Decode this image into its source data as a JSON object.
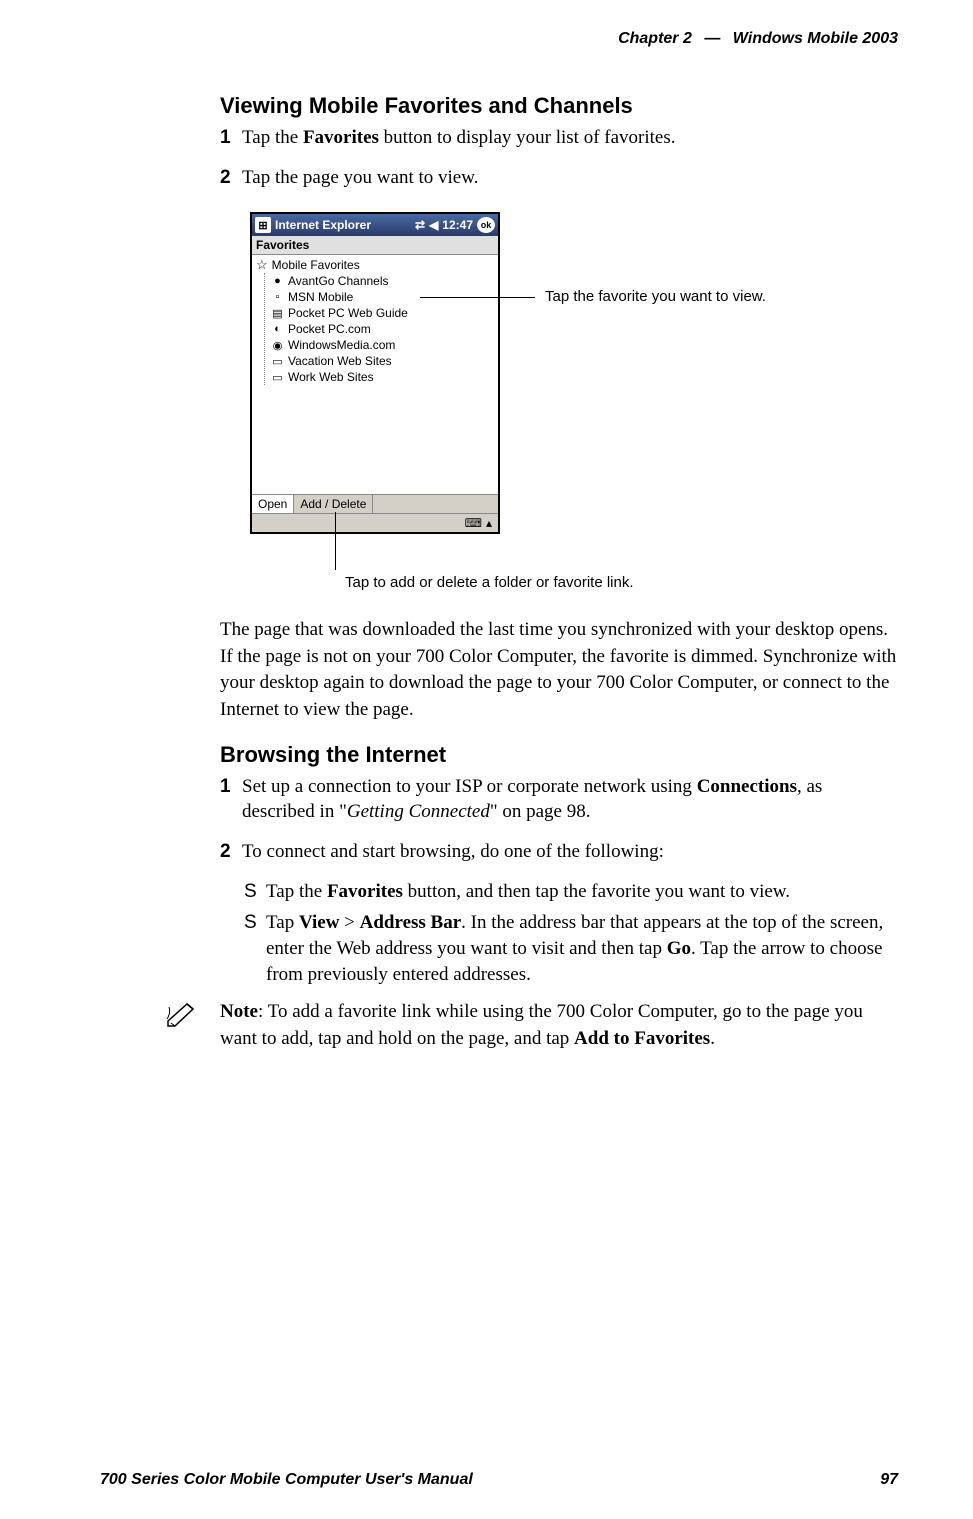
{
  "header": {
    "chapter_label": "Chapter",
    "chapter_number": "2",
    "dash": "—",
    "product": "Windows Mobile 2003"
  },
  "section1": {
    "title": "Viewing Mobile Favorites and Channels",
    "step1_num": "1",
    "step1_a": "Tap the ",
    "step1_b": "Favorites",
    "step1_c": " button to display your list of favorites.",
    "step2_num": "2",
    "step2": "Tap the page you want to view."
  },
  "screenshot": {
    "titlebar_app": "Internet Explorer",
    "titlebar_time": "12:47",
    "titlebar_ok": "ok",
    "subhead": "Favorites",
    "root": "Mobile Favorites",
    "items": {
      "i0": "AvantGo Channels",
      "i1": "MSN Mobile",
      "i2": "Pocket PC Web Guide",
      "i3": "Pocket PC.com",
      "i4": "WindowsMedia.com",
      "i5": "Vacation Web Sites",
      "i6": "Work Web Sites"
    },
    "tab_open": "Open",
    "tab_adddel": "Add / Delete",
    "kbd_glyph": "⌨",
    "arrow_glyph": "▴"
  },
  "callouts": {
    "c1": "Tap the favorite you want to view.",
    "c2": "Tap to add or delete a folder or favorite link."
  },
  "para_after": "The page that was downloaded the last time you synchronized with your desktop opens. If the page is not on your 700 Color Computer, the favorite is dimmed. Synchronize with your desktop again to download the page to your 700 Color Computer, or connect to the Internet to view the page.",
  "section2": {
    "title": "Browsing the Internet",
    "step1_num": "1",
    "step1_a": "Set up a connection to your ISP or corporate network using ",
    "step1_b": "Connections",
    "step1_c": ", as described in \"",
    "step1_d": "Getting Connected",
    "step1_e": "\" on page 98.",
    "step2_num": "2",
    "step2": "To connect and start browsing, do one of the following:",
    "bullet1_a": "Tap the ",
    "bullet1_b": "Favorites",
    "bullet1_c": " button, and then tap the favorite you want to view.",
    "bullet2_a": "Tap ",
    "bullet2_b": "View",
    "bullet2_c": " > ",
    "bullet2_d": "Address Bar",
    "bullet2_e": ". In the address bar that appears at the top of the screen, enter the Web address you want to visit and then tap ",
    "bullet2_f": "Go",
    "bullet2_g": ". Tap the arrow to choose from previously entered addresses."
  },
  "note": {
    "label": "Note",
    "text_a": ": To add a favorite link while using the 700 Color Computer, go to the page you want to add, tap and hold on the page, and tap ",
    "text_b": "Add to Favorites",
    "text_c": "."
  },
  "footer": {
    "manual": "700 Series Color Mobile Computer User's Manual",
    "page": "97"
  }
}
